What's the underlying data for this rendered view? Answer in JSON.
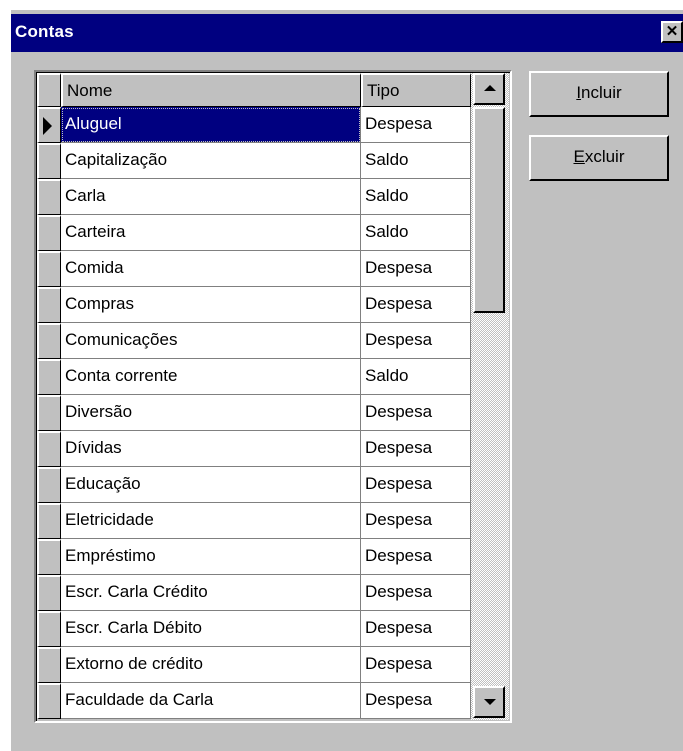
{
  "window": {
    "title": "Contas",
    "close_glyph": "✕"
  },
  "grid": {
    "columns": [
      "Nome",
      "Tipo"
    ],
    "rows": [
      [
        "Aluguel",
        "Despesa"
      ],
      [
        "Capitalização",
        "Saldo"
      ],
      [
        "Carla",
        "Saldo"
      ],
      [
        "Carteira",
        "Saldo"
      ],
      [
        "Comida",
        "Despesa"
      ],
      [
        "Compras",
        "Despesa"
      ],
      [
        "Comunicações",
        "Despesa"
      ],
      [
        "Conta corrente",
        "Saldo"
      ],
      [
        "Diversão",
        "Despesa"
      ],
      [
        "Dívidas",
        "Despesa"
      ],
      [
        "Educação",
        "Despesa"
      ],
      [
        "Eletricidade",
        "Despesa"
      ],
      [
        "Empréstimo",
        "Despesa"
      ],
      [
        "Escr. Carla Crédito",
        "Despesa"
      ],
      [
        "Escr. Carla Débito",
        "Despesa"
      ],
      [
        "Extorno de crédito",
        "Despesa"
      ],
      [
        "Faculdade da Carla",
        "Despesa"
      ]
    ],
    "selected_row": 0
  },
  "buttons": {
    "incluir": {
      "mnemonic": "I",
      "rest": "ncluir"
    },
    "excluir": {
      "mnemonic": "E",
      "rest": "xcluir"
    }
  },
  "colors": {
    "titlebar": "#000080",
    "face": "#c0c0c0",
    "selection": "#000080"
  }
}
